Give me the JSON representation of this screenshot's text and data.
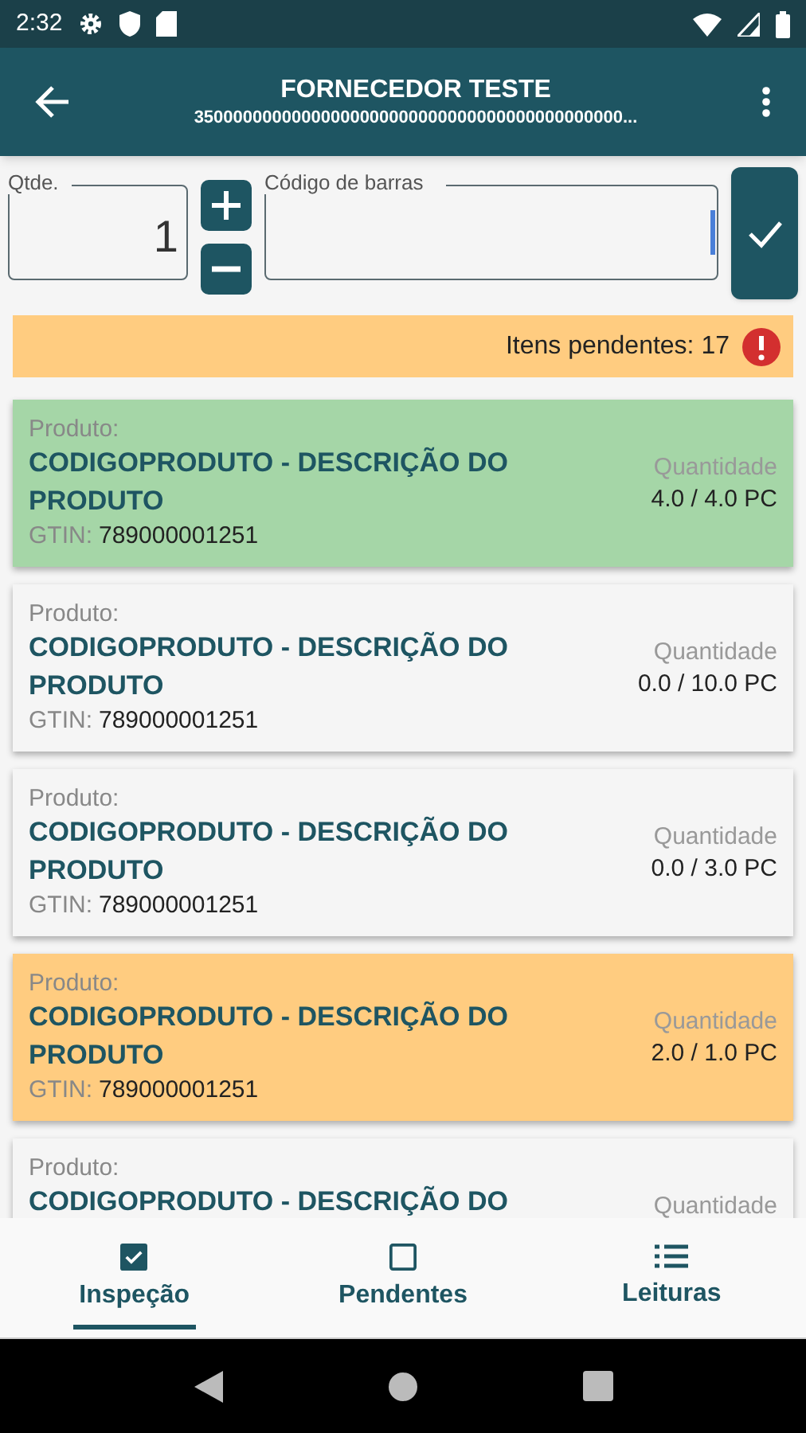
{
  "status_bar": {
    "time": "2:32"
  },
  "app_bar": {
    "title": "FORNECEDOR TESTE",
    "subtitle": "35000000000000000000000000000000000000000000..."
  },
  "quantity_field": {
    "label": "Qtde.",
    "value": "1"
  },
  "barcode_field": {
    "label": "Código de barras",
    "focused": true
  },
  "pending_banner": {
    "text": "Itens pendentes: 17"
  },
  "items": [
    {
      "color": "#a5d6a7",
      "label": "Produto:",
      "name": "CODIGOPRODUTO - DESCRIÇÃO DO PRODUTO",
      "gtin_label": "GTIN:",
      "gtin": "789000001251",
      "quantity_label": "Quantidade",
      "quantity": "4.0 / 4.0 PC"
    },
    {
      "color": "#f5f5f5",
      "label": "Produto:",
      "name": "CODIGOPRODUTO - DESCRIÇÃO DO PRODUTO",
      "gtin_label": "GTIN:",
      "gtin": "789000001251",
      "quantity_label": "Quantidade",
      "quantity": "0.0 / 10.0 PC"
    },
    {
      "color": "#f5f5f5",
      "label": "Produto:",
      "name": "CODIGOPRODUTO - DESCRIÇÃO DO PRODUTO",
      "gtin_label": "GTIN:",
      "gtin": "789000001251",
      "quantity_label": "Quantidade",
      "quantity": "0.0 / 3.0 PC"
    },
    {
      "color": "#ffcc80",
      "label": "Produto:",
      "name": "CODIGOPRODUTO - DESCRIÇÃO DO PRODUTO",
      "gtin_label": "GTIN:",
      "gtin": "789000001251",
      "quantity_label": "Quantidade",
      "quantity": "2.0 / 1.0 PC"
    },
    {
      "color": "#f5f5f5",
      "label": "Produto:",
      "name": "CODIGOPRODUTO - DESCRIÇÃO DO",
      "quantity_label": "Quantidade"
    }
  ],
  "bottom_nav": [
    {
      "kind": "checked",
      "label": "Inspeção",
      "selected": true
    },
    {
      "kind": "box",
      "label": "Pendentes",
      "selected": false
    },
    {
      "kind": "list",
      "label": "Leituras",
      "selected": false
    }
  ]
}
